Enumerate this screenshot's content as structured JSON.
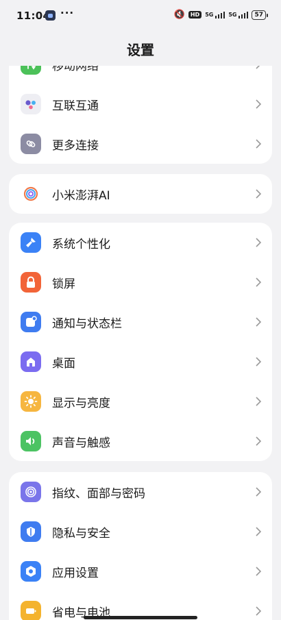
{
  "status": {
    "time": "11:04",
    "dots": "···",
    "hd": "HD",
    "sig1": "5G",
    "sig2": "5G",
    "battery": "57"
  },
  "page_title": "设置",
  "cards": [
    {
      "items": [
        {
          "id": "mobile-network",
          "label": "移动网络",
          "icon": "mobile-network-icon",
          "color": "#4cc159"
        },
        {
          "id": "interconnect",
          "label": "互联互通",
          "icon": "interconnect-icon",
          "color": "#eeeef3"
        },
        {
          "id": "more-connections",
          "label": "更多连接",
          "icon": "link-icon",
          "color": "#8c8ca3"
        }
      ]
    },
    {
      "items": [
        {
          "id": "hyperai",
          "label": "小米澎湃AI",
          "icon": "hyperai-icon",
          "color": "#ffffff"
        }
      ]
    },
    {
      "items": [
        {
          "id": "personalization",
          "label": "系统个性化",
          "icon": "brush-icon",
          "color": "#3b82f6"
        },
        {
          "id": "lock-screen",
          "label": "锁屏",
          "icon": "lock-icon",
          "color": "#f26438"
        },
        {
          "id": "notifications",
          "label": "通知与状态栏",
          "icon": "notification-icon",
          "color": "#3f7cf0"
        },
        {
          "id": "home-screen",
          "label": "桌面",
          "icon": "home-icon",
          "color": "#7b6cf0"
        },
        {
          "id": "display",
          "label": "显示与亮度",
          "icon": "sun-icon",
          "color": "#f6b640"
        },
        {
          "id": "sound",
          "label": "声音与触感",
          "icon": "speaker-icon",
          "color": "#4cc363"
        }
      ]
    },
    {
      "items": [
        {
          "id": "fingerprint",
          "label": "指纹、面部与密码",
          "icon": "fingerprint-icon",
          "color": "#7a75ea"
        },
        {
          "id": "privacy",
          "label": "隐私与安全",
          "icon": "shield-icon",
          "color": "#3f7cf0"
        },
        {
          "id": "app-settings",
          "label": "应用设置",
          "icon": "app-settings-icon",
          "color": "#3b82f6"
        },
        {
          "id": "battery",
          "label": "省电与电池",
          "icon": "battery-icon",
          "color": "#f4b32e"
        }
      ]
    }
  ]
}
